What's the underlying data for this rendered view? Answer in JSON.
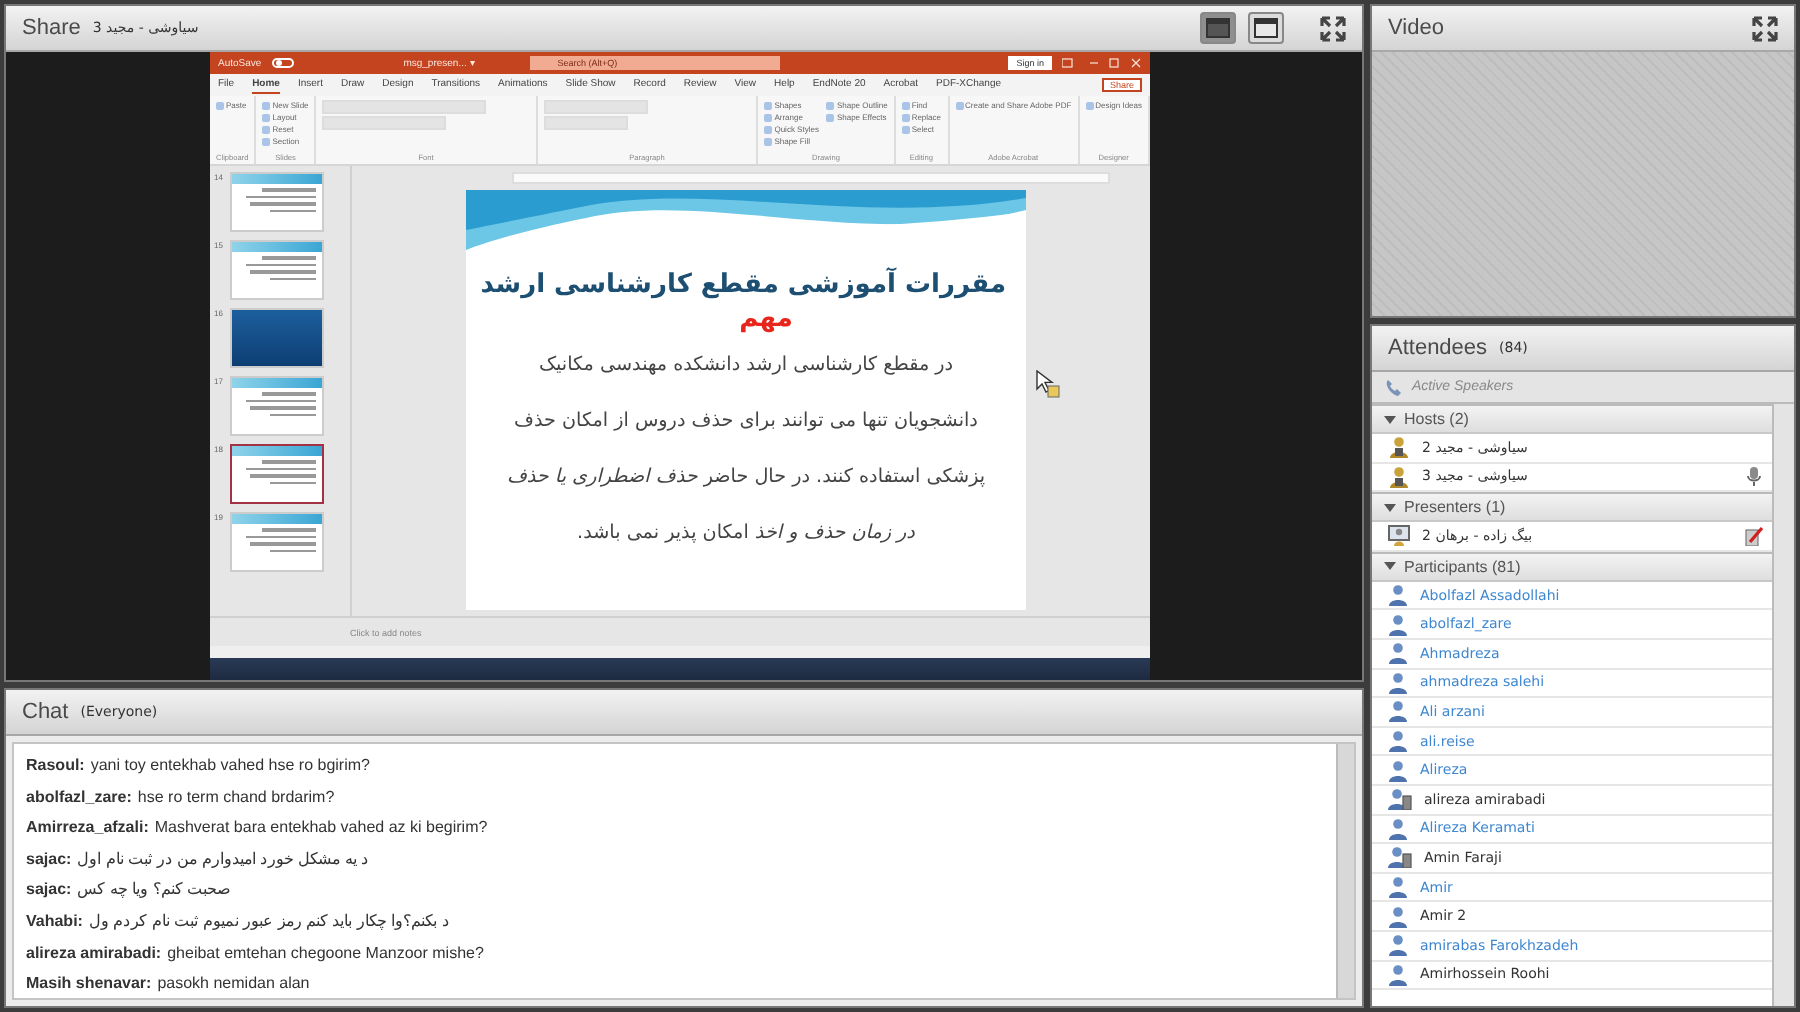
{
  "share": {
    "title": "Share",
    "subtitle": "سیاوشی - مجید 3",
    "layout_buttons": [
      {
        "selected": true
      },
      {
        "selected": false
      }
    ],
    "powerpoint": {
      "autosave": "AutoSave",
      "autosave_on": false,
      "file_name": "msg_presen... ▾",
      "search": "Search (Alt+Q)",
      "sign_in": "Sign in",
      "share": "Share",
      "tabs": [
        {
          "label": "File",
          "selected": false
        },
        {
          "label": "Home",
          "selected": true
        },
        {
          "label": "Insert",
          "selected": false
        },
        {
          "label": "Draw",
          "selected": false
        },
        {
          "label": "Design",
          "selected": false
        },
        {
          "label": "Transitions",
          "selected": false
        },
        {
          "label": "Animations",
          "selected": false
        },
        {
          "label": "Slide Show",
          "selected": false
        },
        {
          "label": "Record",
          "selected": false
        },
        {
          "label": "Review",
          "selected": false
        },
        {
          "label": "View",
          "selected": false
        },
        {
          "label": "Help",
          "selected": false
        },
        {
          "label": "EndNote 20",
          "selected": false
        },
        {
          "label": "Acrobat",
          "selected": false
        },
        {
          "label": "PDF-XChange",
          "selected": false
        }
      ],
      "groups": [
        {
          "label": "Clipboard",
          "buttons": [
            "Paste"
          ]
        },
        {
          "label": "Slides",
          "buttons": [
            "New Slide",
            "Layout",
            "Reset",
            "Section"
          ]
        },
        {
          "label": "Font"
        },
        {
          "label": "Paragraph"
        },
        {
          "label": "Drawing",
          "buttons": [
            "Shapes",
            "Arrange",
            "Quick Styles",
            "Shape Fill",
            "Shape Outline",
            "Shape Effects"
          ]
        },
        {
          "label": "Editing",
          "buttons": [
            "Find",
            "Replace",
            "Select"
          ]
        },
        {
          "label": "Adobe Acrobat",
          "buttons": [
            "Create and Share Adobe PDF"
          ]
        },
        {
          "label": "Designer",
          "buttons": [
            "Design Ideas"
          ]
        }
      ],
      "thumbnails": [
        {
          "number": "14",
          "kind": "text",
          "selected": false
        },
        {
          "number": "15",
          "kind": "text",
          "selected": false
        },
        {
          "number": "16",
          "kind": "title",
          "selected": false
        },
        {
          "number": "17",
          "kind": "text",
          "selected": false
        },
        {
          "number": "18",
          "kind": "text",
          "selected": true
        },
        {
          "number": "19",
          "kind": "text",
          "selected": false
        }
      ],
      "slide": {
        "title": "مقررات آموزشی مقطع کارشناسی ارشد",
        "label": "مهم",
        "body": "در مقطع کارشناسی ارشد دانشکده مهندسی مکانیک دانشجویان تنها می توانند برای حذف دروس از امکان حذف پزشکی استفاده کنند. در حال حاضر *حذف اضطراری یا حذف در زمان حذف و اخذ* امکان پذیر نمی باشد."
      },
      "notes_placeholder": "Click to add notes"
    }
  },
  "chat": {
    "title": "Chat",
    "audience": "(Everyone)",
    "messages": [
      {
        "sender": "Rasoul:",
        "text": "yani toy entekhab vahed hse ro bgirim?"
      },
      {
        "sender": "abolfazl_zare:",
        "text": "hse ro term chand brdarim?"
      },
      {
        "sender": "Amirreza_afzali:",
        "text": "Mashverat bara entekhab vahed az ki begirim?"
      },
      {
        "sender": "sajac:",
        "text": "د یه مشکل خورد امیدوارم من در ثبت نام اول"
      },
      {
        "sender": "sajac:",
        "text": "صحبت کنم؟ ویا چه کس"
      },
      {
        "sender": "Vahabi:",
        "text": "د بکنم؟وا چکار باید کنم رمز عبور نمیوم ثبت نام کردم ول"
      },
      {
        "sender": "alireza amirabadi:",
        "text": "gheibat emtehan chegoone Manzoor mishe?"
      },
      {
        "sender": "Masih shenavar:",
        "text": "pasokh nemidan alan"
      }
    ]
  },
  "video": {
    "title": "Video"
  },
  "attendees": {
    "title": "Attendees",
    "count": "(84)",
    "active_speakers": "Active Speakers",
    "sections": [
      {
        "title": "Hosts (2)",
        "expanded": true,
        "people": [
          {
            "name": "سیاوشی - مجید 2",
            "kind": "host",
            "mic": false,
            "pen": false,
            "highlighted": false
          },
          {
            "name": "سیاوشی - مجید 3",
            "kind": "host",
            "mic": true,
            "pen": false,
            "highlighted": false
          }
        ]
      },
      {
        "title": "Presenters (1)",
        "expanded": true,
        "people": [
          {
            "name": "بیگ زاده - برهان 2",
            "kind": "presenter",
            "mic": false,
            "pen": true,
            "highlighted": false
          }
        ]
      },
      {
        "title": "Participants (81)",
        "expanded": true,
        "people": [
          {
            "name": "Abolfazl Assadollahi",
            "kind": "user",
            "highlighted": true
          },
          {
            "name": "abolfazl_zare",
            "kind": "user",
            "highlighted": true
          },
          {
            "name": "Ahmadreza",
            "kind": "user",
            "highlighted": true
          },
          {
            "name": "ahmadreza salehi",
            "kind": "user",
            "highlighted": true
          },
          {
            "name": "Ali arzani",
            "kind": "user",
            "highlighted": true
          },
          {
            "name": "ali.reise",
            "kind": "user",
            "highlighted": true
          },
          {
            "name": "Alireza",
            "kind": "user",
            "highlighted": true
          },
          {
            "name": "alireza amirabadi",
            "kind": "device",
            "highlighted": false
          },
          {
            "name": "Alireza Keramati",
            "kind": "user",
            "highlighted": true
          },
          {
            "name": "Amin Faraji",
            "kind": "device",
            "highlighted": false
          },
          {
            "name": "Amir",
            "kind": "user",
            "highlighted": true
          },
          {
            "name": "Amir 2",
            "kind": "user",
            "highlighted": false
          },
          {
            "name": "amirabas Farokhzadeh",
            "kind": "user",
            "highlighted": true
          },
          {
            "name": "Amirhossein Roohi",
            "kind": "user",
            "highlighted": false
          }
        ]
      }
    ]
  }
}
